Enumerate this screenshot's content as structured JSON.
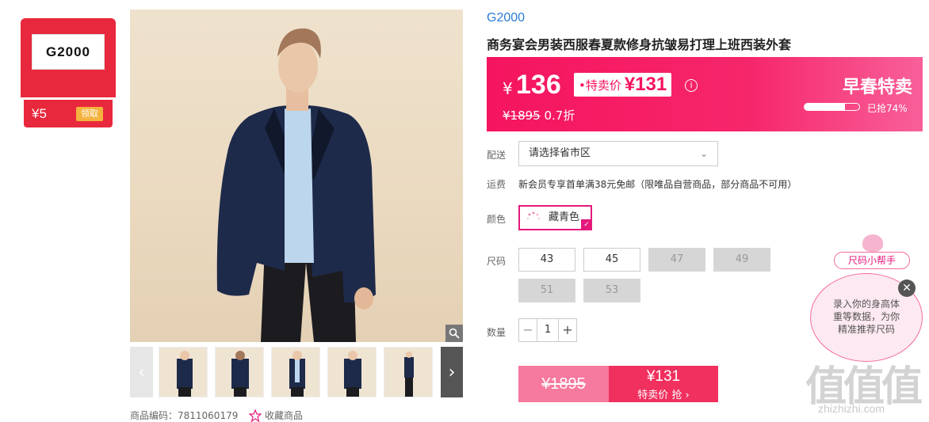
{
  "coupon": {
    "logo": "G2000",
    "value": "¥5",
    "button": "领取"
  },
  "gallery": {
    "zoom_icon": "zoom-icon",
    "prev": "‹",
    "next": "›"
  },
  "meta": {
    "code_label": "商品编码：7811060179",
    "favorite": "收藏商品"
  },
  "product": {
    "brand": "G2000",
    "title": "商务宴会男装西服春夏款修身抗皱易打理上班西装外套"
  },
  "price": {
    "yen": "¥",
    "main": "136",
    "tag_label": "•特卖价",
    "tag_value": "¥131",
    "original": "¥1895",
    "discount": "0.7折",
    "promo": "早春特卖",
    "sold_label": "已抢74%",
    "progress": 0.74
  },
  "delivery": {
    "label": "配送",
    "placeholder": "请选择省市区"
  },
  "shipping": {
    "label": "运费",
    "text": "新会员专享首单满38元免邮（限唯品自营商品，部分商品不可用）"
  },
  "color": {
    "label": "颜色",
    "selected": "藏青色"
  },
  "size": {
    "label": "尺码",
    "options": [
      {
        "value": "43",
        "available": true
      },
      {
        "value": "45",
        "available": true
      },
      {
        "value": "47",
        "available": false
      },
      {
        "value": "49",
        "available": false
      },
      {
        "value": "51",
        "available": false
      },
      {
        "value": "53",
        "available": false
      }
    ]
  },
  "quantity": {
    "label": "数量",
    "value": "1",
    "minus": "−",
    "plus": "+"
  },
  "buy": {
    "original": "¥1895",
    "price": "¥131",
    "cta": "特卖价 抢 ›"
  },
  "helper": {
    "tag": "尺码小帮手",
    "text_1": "录入你的身高体",
    "text_2": "重等数据，为你",
    "text_3": "精准推荐尺码",
    "close": "✕"
  },
  "watermark": {
    "zh": "值值值",
    "url": "zhizhizhi.com"
  },
  "colors": {
    "accent": "#f5145f",
    "brand_blue": "#2a7bd6",
    "coupon_red": "#e8283c"
  }
}
